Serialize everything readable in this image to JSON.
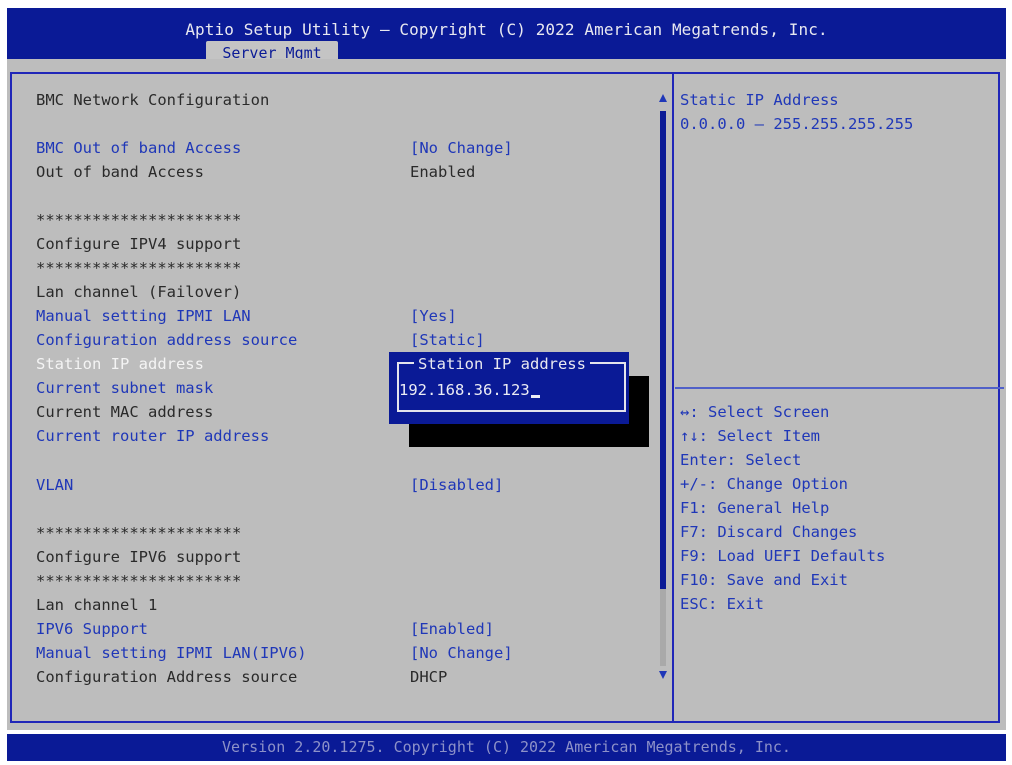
{
  "header": {
    "title": "Aptio Setup Utility – Copyright (C) 2022 American Megatrends, Inc.",
    "tab": "Server Mgmt"
  },
  "settings": {
    "section_title": "BMC Network Configuration",
    "rows": [
      {
        "label": "BMC Out of band Access",
        "value": "[No Change]"
      },
      {
        "label": "Out of band Access",
        "value": "Enabled"
      },
      {
        "label": "**********************"
      },
      {
        "label": "Configure IPV4 support"
      },
      {
        "label": "**********************"
      },
      {
        "label": "Lan channel (Failover)"
      },
      {
        "label": "Manual setting IPMI LAN",
        "value": "[Yes]"
      },
      {
        "label": "Configuration address source",
        "value": "[Static]"
      },
      {
        "label": "Station IP address"
      },
      {
        "label": "Current subnet mask"
      },
      {
        "label": "Current MAC address"
      },
      {
        "label": "Current router IP address"
      },
      {
        "label": "VLAN",
        "value": "[Disabled]"
      },
      {
        "label": "**********************"
      },
      {
        "label": "Configure IPV6 support"
      },
      {
        "label": "**********************"
      },
      {
        "label": "Lan channel 1"
      },
      {
        "label": "IPV6 Support",
        "value": "[Enabled]"
      },
      {
        "label": "Manual setting IPMI LAN(IPV6)",
        "value": "[No Change]"
      },
      {
        "label": "Configuration Address source",
        "value": "DHCP"
      }
    ]
  },
  "popup": {
    "title": "Station IP address",
    "input_value": "192.168.36.123"
  },
  "help": {
    "line1": "Static IP Address",
    "line2": "0.0.0.0 – 255.255.255.255"
  },
  "keys": [
    "↔: Select Screen",
    "↑↓: Select Item",
    "Enter: Select",
    "+/-: Change Option",
    "F1: General Help",
    "F7: Discard Changes",
    "F9: Load UEFI Defaults",
    "F10: Save and Exit",
    "ESC: Exit"
  ],
  "footer": "Version 2.20.1275. Copyright (C) 2022 American Megatrends, Inc.",
  "colors": {
    "header_bg": "#0a1a96",
    "panel_bg": "#bdbdbd",
    "link_text": "#1f37b8",
    "selected_text": "#f4f4f4"
  }
}
